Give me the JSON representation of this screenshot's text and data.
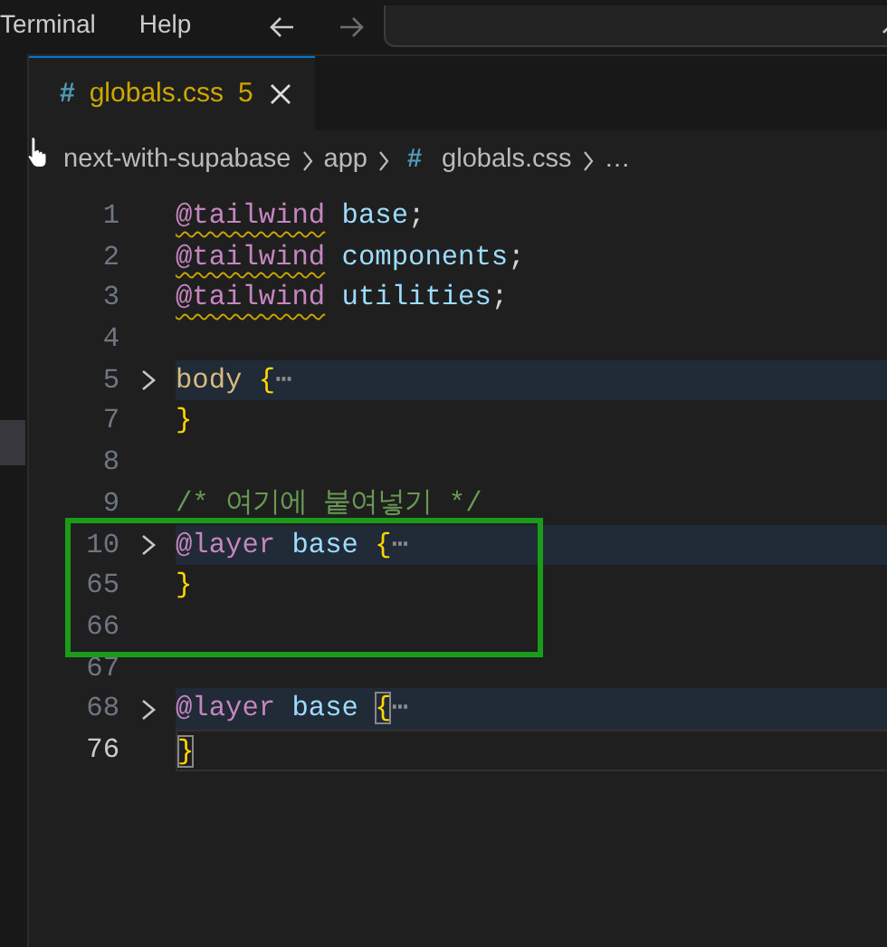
{
  "menu": [
    {
      "label": "Terminal"
    },
    {
      "label": "Help"
    }
  ],
  "navigation": [
    {
      "kind": "back",
      "disabled": false
    },
    {
      "kind": "forward",
      "disabled": true
    }
  ],
  "tabs": [
    {
      "icon": "#",
      "label": "globals.css",
      "badge": "5",
      "selected": true,
      "warning": true
    }
  ],
  "breadcrumbs": [
    {
      "label": "next-with-supabase"
    },
    {
      "label": "app"
    },
    {
      "icon": "#",
      "label": "globals.css"
    },
    {
      "label": "…"
    }
  ],
  "lines": [
    {
      "kind": "line",
      "number": "1",
      "tokens": [
        {
          "text": "@tailwind",
          "kind": "directive",
          "warning": true
        },
        {
          "text": " base",
          "kind": "value"
        },
        {
          "text": ";",
          "kind": "punct"
        }
      ]
    },
    {
      "kind": "line",
      "number": "2",
      "tokens": [
        {
          "text": "@tailwind",
          "kind": "directive",
          "warning": true
        },
        {
          "text": " components",
          "kind": "value"
        },
        {
          "text": ";",
          "kind": "punct"
        }
      ]
    },
    {
      "kind": "line",
      "number": "3",
      "tokens": [
        {
          "text": "@tailwind",
          "kind": "directive",
          "warning": true
        },
        {
          "text": " utilities",
          "kind": "value"
        },
        {
          "text": ";",
          "kind": "punct"
        }
      ]
    },
    {
      "kind": "line",
      "number": "4"
    },
    {
      "kind": "line",
      "number": "5",
      "folded": true,
      "tokens": [
        {
          "text": "body ",
          "kind": "selector"
        },
        {
          "text": "{",
          "kind": "brace"
        },
        {
          "text": "⋯",
          "kind": "ellipsis"
        }
      ]
    },
    {
      "kind": "line",
      "number": "7",
      "tokens": [
        {
          "text": "}",
          "kind": "brace"
        }
      ]
    },
    {
      "kind": "line",
      "number": "8"
    },
    {
      "kind": "line",
      "number": "9",
      "tokens": [
        {
          "text": "/* 여기에 붙여넣기 */",
          "kind": "comment"
        }
      ]
    },
    {
      "kind": "box",
      "color": "#1a9c1a",
      "lines": [
        {
          "kind": "line",
          "number": "10",
          "folded": true,
          "tokens": [
            {
              "text": "@layer",
              "kind": "directive"
            },
            {
              "text": " base ",
              "kind": "value"
            },
            {
              "text": "{",
              "kind": "brace"
            },
            {
              "text": "⋯",
              "kind": "ellipsis"
            }
          ]
        },
        {
          "kind": "line",
          "number": "65",
          "tokens": [
            {
              "text": "}",
              "kind": "brace"
            }
          ]
        },
        {
          "kind": "line",
          "number": "66"
        }
      ]
    },
    {
      "kind": "line",
      "number": "67"
    },
    {
      "kind": "line",
      "number": "68",
      "folded": true,
      "tokens": [
        {
          "text": "@layer",
          "kind": "directive"
        },
        {
          "text": " base ",
          "kind": "value"
        },
        {
          "text": "{",
          "kind": "brace",
          "matched": true
        },
        {
          "text": "⋯",
          "kind": "ellipsis"
        }
      ]
    },
    {
      "kind": "line",
      "number": "76",
      "current": true,
      "tokens": [
        {
          "text": "}",
          "kind": "brace",
          "matched": true
        }
      ]
    }
  ]
}
